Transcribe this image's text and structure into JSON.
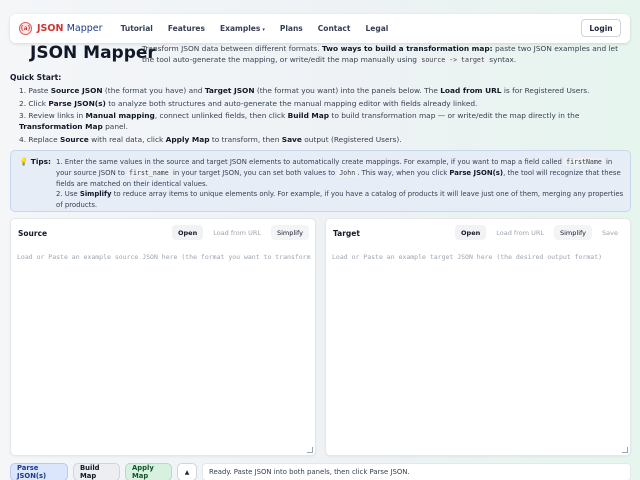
{
  "brand": {
    "logo_text": "{a}",
    "name_part1": "JSON",
    "name_part2": "Mapper"
  },
  "nav": {
    "links": [
      "Tutorial",
      "Features",
      "Examples",
      "Plans",
      "Contact",
      "Legal"
    ],
    "examples_caret": "▾",
    "login": "Login"
  },
  "header": {
    "title": "JSON Mapper",
    "desc_1": "Transform JSON data between different formats. ",
    "desc_bold": "Two ways to build a transformation map:",
    "desc_2": " paste two JSON examples and let the tool auto-generate the mapping, or write/edit the map manually using ",
    "desc_code": "source -> target",
    "desc_3": " syntax."
  },
  "quick_start": {
    "title": "Quick Start:",
    "step1": {
      "n": "1.",
      "a": "Paste ",
      "b1": "Source JSON",
      "c": " (the format you have) and ",
      "b2": "Target JSON",
      "d": " (the format you want) into the panels below. The ",
      "b3": "Load from URL",
      "e": " is for Registered Users."
    },
    "step2": {
      "n": "2.",
      "a": "Click ",
      "b1": "Parse JSON(s)",
      "c": " to analyze both structures and auto-generate the manual mapping editor with fields already linked."
    },
    "step3": {
      "n": "3.",
      "a": "Review links in ",
      "b1": "Manual mapping",
      "c": ", connect unlinked fields, then click ",
      "b2": "Build Map",
      "d": " to build transformation map — or write/edit the map directly in the ",
      "b3": "Transformation Map",
      "e": " panel."
    },
    "step4": {
      "n": "4.",
      "a": "Replace ",
      "b1": "Source",
      "c": " with real data, click ",
      "b2": "Apply Map",
      "d": " to transform, then ",
      "b3": "Save",
      "e": " output (Registered Users)."
    }
  },
  "tips": {
    "icon": "💡",
    "label": "Tips:",
    "tip1": {
      "n": "1.",
      "a": "Enter the same values in the source and target JSON elements to automatically create mappings. For example, if you want to map a field called ",
      "code1": "firstName",
      "b": " in your source JSON to ",
      "code2": "first_name",
      "c": " in your target JSON, you can set both values to ",
      "code3": "John",
      "d": ". This way, when you click ",
      "b1": "Parse JSON(s)",
      "e": ", the tool will recognize that these fields are matched on their identical values."
    },
    "tip2": {
      "n": "2.",
      "a": "Use ",
      "b1": "Simplify",
      "b": " to reduce array items to unique elements only. For example, if you have a catalog of products it will leave just one of them, merging any properties of products."
    }
  },
  "source_panel": {
    "title": "Source",
    "open": "Open",
    "load_url": "Load from URL",
    "simplify": "Simplify",
    "placeholder": "Load or Paste an example source JSON here (the format you want to transform from)"
  },
  "target_panel": {
    "title": "Target",
    "open": "Open",
    "load_url": "Load from URL",
    "simplify": "Simplify",
    "save": "Save",
    "placeholder": "Load or Paste an example target JSON here (the desired output format)"
  },
  "bottom": {
    "parse": "Parse JSON(s)",
    "build": "Build Map",
    "apply": "Apply Map",
    "up": "▲",
    "status": "Ready. Paste JSON into both panels, then click Parse JSON."
  }
}
